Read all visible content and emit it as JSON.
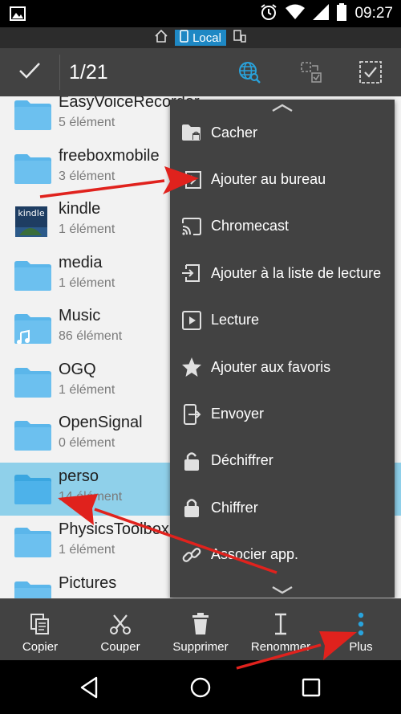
{
  "status_bar": {
    "time": "09:27",
    "icons": [
      "image-icon",
      "alarm-icon",
      "wifi-icon",
      "signal-icon",
      "battery-icon"
    ]
  },
  "location_bar": {
    "label": "Local",
    "icons": [
      "home-icon",
      "phone-icon",
      "devices-icon"
    ]
  },
  "action_bar": {
    "selection_count": "1/21",
    "icons": [
      "check-icon",
      "network-search-icon",
      "select-inverse-icon",
      "select-all-icon"
    ],
    "accent": "#29a3dc"
  },
  "file_list": {
    "items": [
      {
        "name": "EasyVoiceRecorder",
        "sub": "5 élément",
        "icon": "folder-icon",
        "selected": false
      },
      {
        "name": "freeboxmobile",
        "sub": "3 élément",
        "icon": "folder-icon",
        "selected": false
      },
      {
        "name": "kindle",
        "sub": "1 élément",
        "icon": "kindle-folder-icon",
        "selected": false
      },
      {
        "name": "media",
        "sub": "1 élément",
        "icon": "folder-icon",
        "selected": false
      },
      {
        "name": "Music",
        "sub": "86 élément",
        "icon": "music-folder-icon",
        "selected": false
      },
      {
        "name": "OGQ",
        "sub": "1 élément",
        "icon": "folder-icon",
        "selected": false
      },
      {
        "name": "OpenSignal",
        "sub": "0 élément",
        "icon": "folder-icon",
        "selected": false
      },
      {
        "name": "perso",
        "sub": "14 élément",
        "icon": "folder-icon",
        "selected": true
      },
      {
        "name": "PhysicsToolbox",
        "sub": "1 élément",
        "icon": "folder-icon",
        "selected": false
      },
      {
        "name": "Pictures",
        "sub": "",
        "icon": "folder-icon",
        "selected": false
      }
    ],
    "folder_color": "#5bb6ea",
    "selected_color": "#8fd0ea"
  },
  "popup_menu": {
    "items": [
      {
        "label": "Cacher",
        "icon": "hidden-folder-icon"
      },
      {
        "label": "Ajouter au bureau",
        "icon": "add-to-desktop-icon"
      },
      {
        "label": "Chromecast",
        "icon": "cast-icon"
      },
      {
        "label": "Ajouter à la liste de lecture",
        "icon": "add-playlist-icon"
      },
      {
        "label": "Lecture",
        "icon": "play-icon"
      },
      {
        "label": "Ajouter aux favoris",
        "icon": "star-icon"
      },
      {
        "label": "Envoyer",
        "icon": "send-icon"
      },
      {
        "label": "Déchiffrer",
        "icon": "unlock-icon"
      },
      {
        "label": "Chiffrer",
        "icon": "lock-icon"
      },
      {
        "label": "Associer app.",
        "icon": "link-icon"
      }
    ],
    "scroll_icons": [
      "chevron-up-icon",
      "chevron-down-icon"
    ]
  },
  "toolbar": {
    "items": [
      {
        "label": "Copier",
        "icon": "copy-icon"
      },
      {
        "label": "Couper",
        "icon": "scissors-icon"
      },
      {
        "label": "Supprimer",
        "icon": "trash-icon"
      },
      {
        "label": "Renommer",
        "icon": "rename-icon"
      },
      {
        "label": "Plus",
        "icon": "more-vertical-icon"
      }
    ]
  },
  "nav_bar": {
    "icons": [
      "back-icon",
      "home-icon",
      "recents-icon"
    ]
  },
  "annotation_color": "#e0221d"
}
